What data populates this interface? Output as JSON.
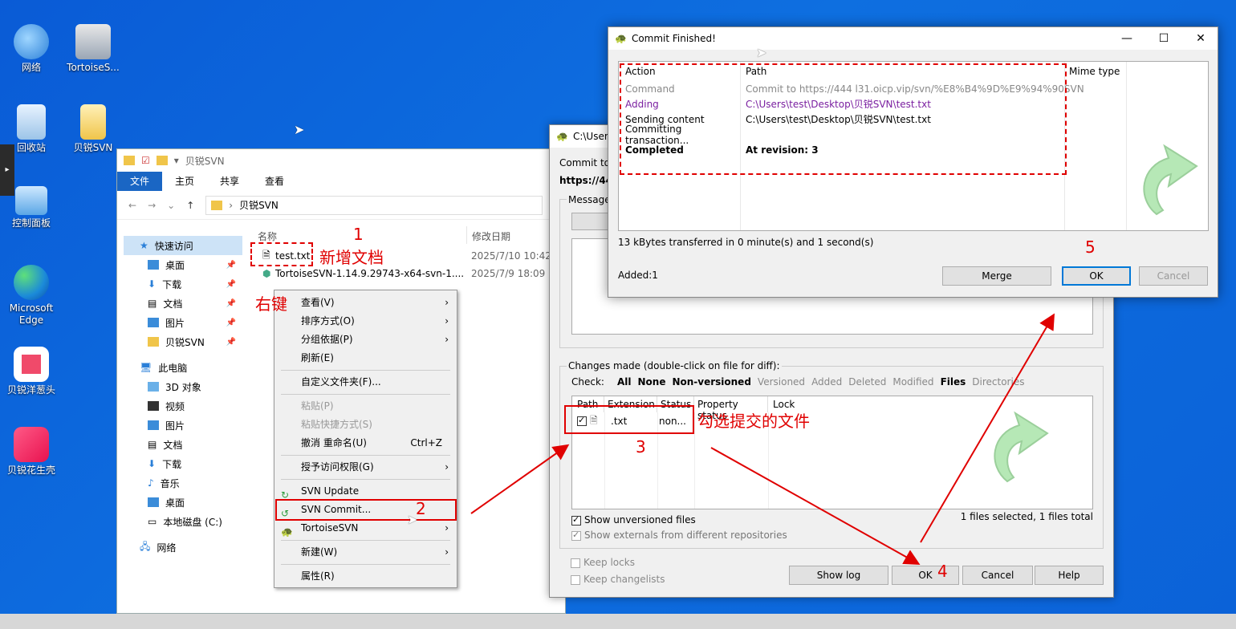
{
  "desktop": {
    "icons": [
      {
        "label": "网络"
      },
      {
        "label": "TortoiseS..."
      },
      {
        "label": "回收站"
      },
      {
        "label": "贝锐SVN"
      },
      {
        "label": "控制面板"
      },
      {
        "label": "Microsoft Edge"
      },
      {
        "label": "贝锐洋葱头"
      },
      {
        "label": "贝锐花生壳"
      }
    ]
  },
  "explorer": {
    "title": "贝锐SVN",
    "tabs": [
      "文件",
      "主页",
      "共享",
      "查看"
    ],
    "address": "贝锐SVN",
    "nav": [
      {
        "label": "快速访问"
      },
      {
        "label": "桌面"
      },
      {
        "label": "下载"
      },
      {
        "label": "文档"
      },
      {
        "label": "图片"
      },
      {
        "label": "贝锐SVN"
      },
      {
        "label": "此电脑"
      },
      {
        "label": "3D 对象"
      },
      {
        "label": "视频"
      },
      {
        "label": "图片"
      },
      {
        "label": "文档"
      },
      {
        "label": "下载"
      },
      {
        "label": "音乐"
      },
      {
        "label": "桌面"
      },
      {
        "label": "本地磁盘 (C:)"
      },
      {
        "label": "网络"
      }
    ],
    "columns": {
      "name": "名称",
      "modified": "修改日期"
    },
    "files": [
      {
        "name": "test.txt",
        "modified": "2025/7/10 10:42"
      },
      {
        "name": "TortoiseSVN-1.14.9.29743-x64-svn-1....",
        "modified": "2025/7/9 18:09"
      }
    ]
  },
  "context_menu": {
    "items": [
      {
        "label": "查看(V)"
      },
      {
        "label": "排序方式(O)"
      },
      {
        "label": "分组依据(P)"
      },
      {
        "label": "刷新(E)"
      },
      {
        "label": "自定义文件夹(F)..."
      },
      {
        "label": "粘贴(P)"
      },
      {
        "label": "粘贴快捷方式(S)"
      },
      {
        "label": "撤消 重命名(U)",
        "shortcut": "Ctrl+Z"
      },
      {
        "label": "授予访问权限(G)"
      },
      {
        "label": "SVN Update"
      },
      {
        "label": "SVN Commit..."
      },
      {
        "label": "TortoiseSVN"
      },
      {
        "label": "新建(W)"
      },
      {
        "label": "属性(R)"
      }
    ]
  },
  "commit_dialog": {
    "title": "C:\\User",
    "commit_to_label": "Commit to:",
    "commit_to_url": "https://444",
    "message_label": "Message:",
    "changes_label": "Changes made (double-click on file for diff):",
    "check_label": "Check:",
    "check_filters": [
      "All",
      "None",
      "Non-versioned",
      "Versioned",
      "Added",
      "Deleted",
      "Modified",
      "Files",
      "Directories"
    ],
    "columns": [
      "Path",
      "Extension",
      "Status",
      "Property status",
      "Lock"
    ],
    "row": {
      "extension": ".txt",
      "status": "non..."
    },
    "show_unversioned": "Show unversioned files",
    "show_externals": "Show externals from different repositories",
    "summary": "1 files selected, 1 files total",
    "keep_locks": "Keep locks",
    "keep_changelists": "Keep changelists",
    "buttons": {
      "show_log": "Show log",
      "ok": "OK",
      "cancel": "Cancel",
      "help": "Help"
    }
  },
  "finished_dialog": {
    "title": "Commit Finished!",
    "columns": {
      "action": "Action",
      "path": "Path",
      "mime": "Mime type"
    },
    "rows": [
      {
        "action": "Command",
        "path": "Commit to https://444      l31.oicp.vip/svn/%E8%B4%9D%E9%94%90SVN"
      },
      {
        "action": "Adding",
        "path": "C:\\Users\\test\\Desktop\\贝锐SVN\\test.txt"
      },
      {
        "action": "Sending content",
        "path": "C:\\Users\\test\\Desktop\\贝锐SVN\\test.txt"
      },
      {
        "action": "Committing transaction...",
        "path": ""
      },
      {
        "action": "Completed",
        "path": "At revision: 3"
      }
    ],
    "transfer": "13 kBytes transferred in 0 minute(s) and 1 second(s)",
    "added": "Added:1",
    "buttons": {
      "merge": "Merge",
      "ok": "OK",
      "cancel": "Cancel"
    }
  },
  "annotations": {
    "n1": "1",
    "new_doc": "新增文档",
    "right_click": "右键",
    "n2": "2",
    "n3": "3",
    "select_files": "勾选提交的文件",
    "n4": "4",
    "n5": "5"
  }
}
